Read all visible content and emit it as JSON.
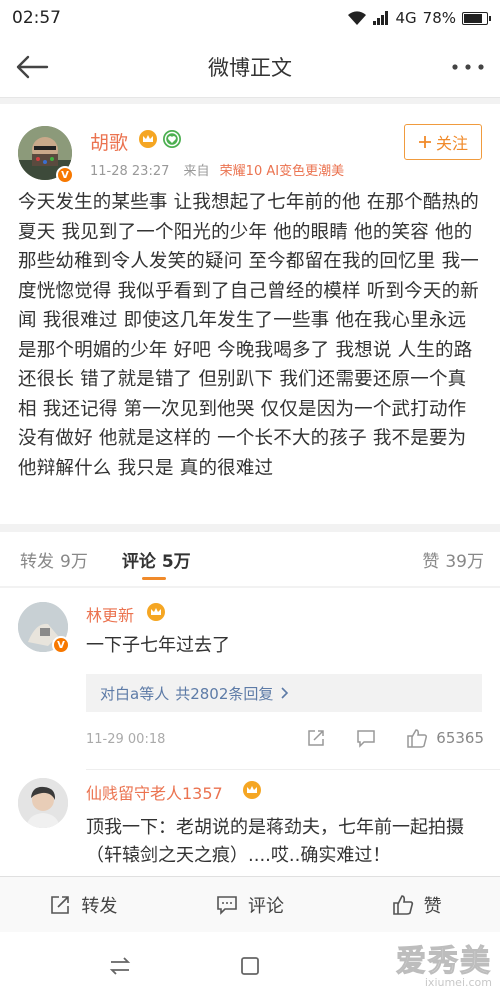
{
  "status_bar": {
    "time": "02:57",
    "network": "4G",
    "battery": "78%"
  },
  "nav": {
    "title": "微博正文"
  },
  "post": {
    "author": "胡歌",
    "time": "11-28 23:27",
    "source_prefix": "来自",
    "source": "荣耀10 AI变色更潮美",
    "follow_label": "关注",
    "text": "今天发生的某些事 让我想起了七年前的他 在那个酷热的夏天 我见到了一个阳光的少年 他的眼睛 他的笑容 他的那些幼稚到令人发笑的疑问 至今都留在我的回忆里 我一度恍惚觉得 我似乎看到了自己曾经的模样 听到今天的新闻 我很难过 即使这几年发生了一些事 他在我心里永远是那个明媚的少年 好吧 今晚我喝多了 我想说 人生的路还很长 错了就是错了 但别趴下 我们还需要还原一个真相 我还记得 第一次见到他哭 仅仅是因为一个武打动作没有做好 他就是这样的 一个长不大的孩子 我不是要为他辩解什么 我只是 真的很难过"
  },
  "tabs": {
    "repost": {
      "label": "转发",
      "count": "9万"
    },
    "comment": {
      "label": "评论",
      "count": "5万"
    },
    "like": {
      "label": "赞",
      "count": "39万"
    }
  },
  "comments": [
    {
      "name": "林更新",
      "text": "一下子七年过去了",
      "reply_summary": "对白a等人",
      "reply_count": "共2802条回复",
      "time": "11-29 00:18",
      "likes": "65365"
    },
    {
      "name": "仙贱留守老人1357",
      "text": "顶我一下：老胡说的是蒋劲夫，七年前一起拍摄（轩辕剑之天之痕）....哎..确实难过！"
    }
  ],
  "action_bar": {
    "repost": "转发",
    "comment": "评论",
    "like": "赞"
  },
  "watermark": {
    "brand": "爱秀美",
    "domain": "ixiumei.com"
  },
  "colors": {
    "accent_orange": "#eb7350",
    "follow_border": "#f09b3e",
    "link_blue": "#5d7ba7"
  }
}
